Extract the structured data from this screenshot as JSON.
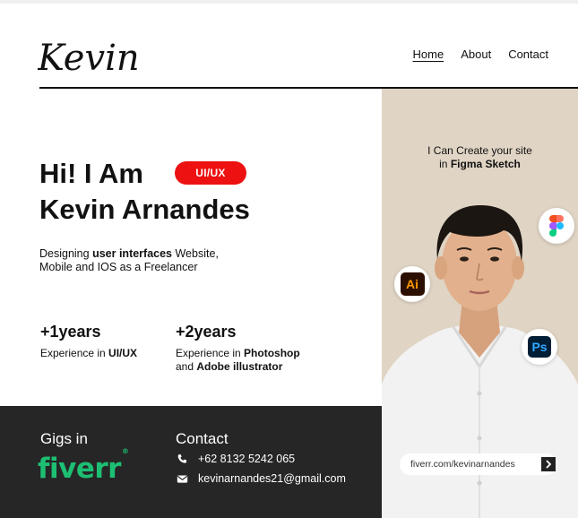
{
  "header": {
    "logo_text": "Kevin .",
    "nav": [
      "Home",
      "About",
      "Contact"
    ]
  },
  "hero": {
    "line1": "Hi! I Am",
    "line2": "Kevin Arnandes",
    "badge": "UI/UX",
    "desc_pre": "Designing ",
    "desc_bold": "user interfaces",
    "desc_post": " Website,",
    "desc_line2": "Mobile and IOS as a Freelancer"
  },
  "stats": [
    {
      "number": "+1years",
      "label_pre": "Experience in ",
      "label_bold": "UI/UX"
    },
    {
      "number": "+2years",
      "label_pre": "Experience in ",
      "label_bold": "Photoshop",
      "label_and": "and ",
      "label_bold2": "Adobe illustrator"
    }
  ],
  "footer": {
    "gigs_title": "Gigs in",
    "fiverr_logo": "fiverr",
    "fiverr_mark": "®",
    "contact_title": "Contact",
    "phone": "+62 8132 5242 065",
    "email": "kevinarnandes21@gmail.com"
  },
  "panel": {
    "line1": "I Can Create your site",
    "line2_pre": "in ",
    "line2_bold": "Figma Sketch",
    "link_text": "fiverr.com/kevinarnandes"
  },
  "icons": {
    "illustrator": "Ai",
    "photoshop": "Ps",
    "figma": "figma-icon"
  },
  "colors": {
    "badge": "#ee1111",
    "footer_bg": "#262626",
    "fiverr_green": "#1dbf73",
    "panel_bg": "#e0d4c4"
  }
}
